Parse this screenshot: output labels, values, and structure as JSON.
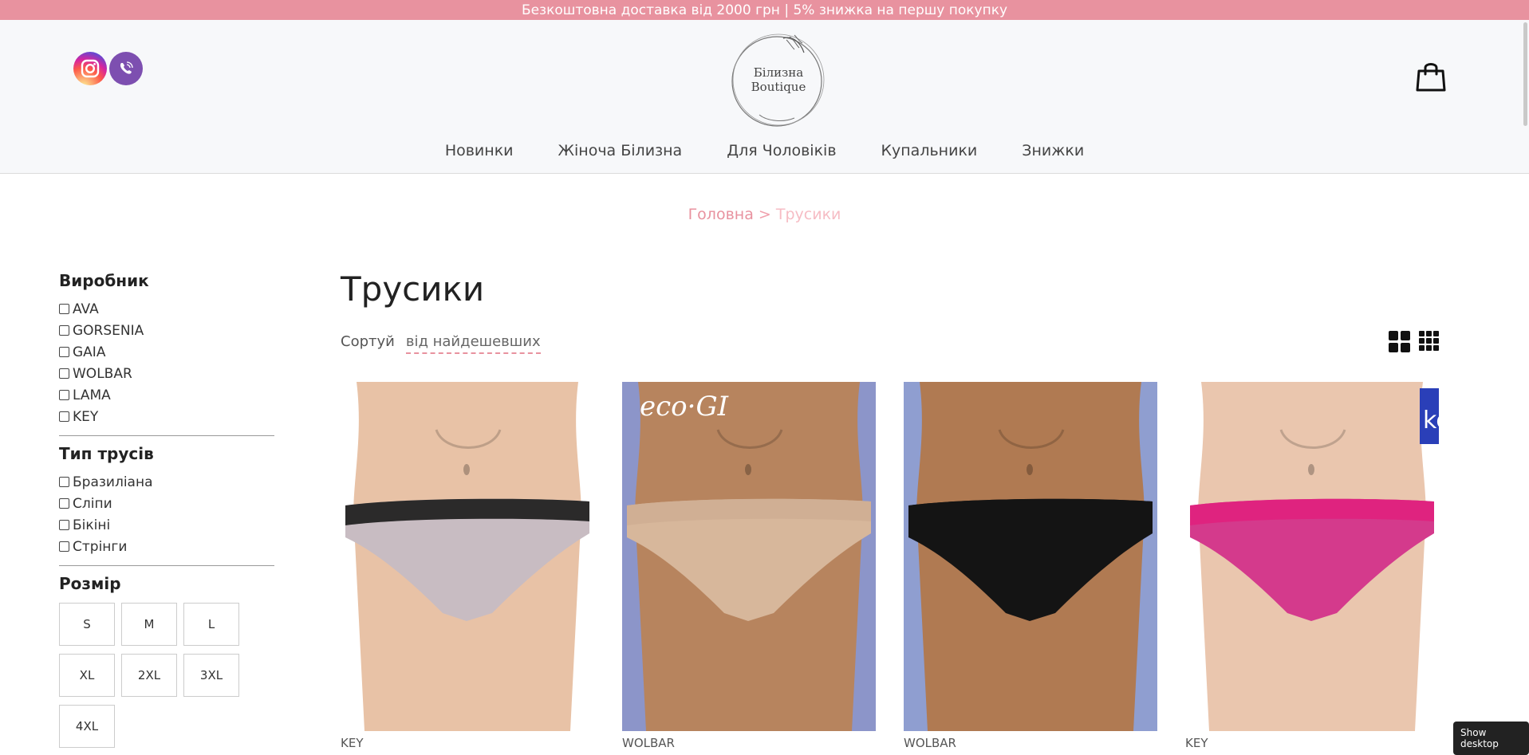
{
  "topbar": {
    "text": "Безкоштовна доставка від 2000 грн | 5% знижка на першу покупку"
  },
  "header": {
    "logo_line1": "Білизна",
    "logo_line2": "Boutique",
    "social": [
      "instagram-icon",
      "viber-icon"
    ],
    "cart_icon": "shopping-bag-icon"
  },
  "nav": {
    "items": [
      {
        "label": "Новинки"
      },
      {
        "label": "Жіноча Білизна"
      },
      {
        "label": "Для Чоловіків"
      },
      {
        "label": "Купальники"
      },
      {
        "label": "Знижки"
      }
    ]
  },
  "breadcrumb": {
    "home": "Головна",
    "sep": ">",
    "current": "Трусики"
  },
  "filters": {
    "maker": {
      "title": "Виробник",
      "options": [
        {
          "label": "AVA"
        },
        {
          "label": "GORSENIA"
        },
        {
          "label": "GAIA"
        },
        {
          "label": "WOLBAR"
        },
        {
          "label": "LAMA"
        },
        {
          "label": "KEY"
        }
      ]
    },
    "type": {
      "title": "Тип трусів",
      "options": [
        {
          "label": "Бразиліана"
        },
        {
          "label": "Сліпи"
        },
        {
          "label": "Бікіні"
        },
        {
          "label": "Стрінги"
        }
      ]
    },
    "size": {
      "title": "Розмір",
      "options": [
        "S",
        "M",
        "L",
        "XL",
        "2XL",
        "3XL",
        "4XL"
      ]
    }
  },
  "main": {
    "title": "Трусики",
    "sort_label": "Сортуй",
    "sort_value": "від найдешевших",
    "view_icons": [
      "grid-2-icon",
      "grid-3-icon"
    ]
  },
  "products": [
    {
      "brand": "KEY",
      "skin": "#e8c2a6",
      "bg": "#ffffff",
      "color": "#c8bcc2",
      "band": "#1a1a1a"
    },
    {
      "brand": "WOLBAR",
      "skin": "#b7845e",
      "bg": "#8c95c9",
      "color": "#d7b79b",
      "band": "#cfae93",
      "overlay": "eco·GI"
    },
    {
      "brand": "WOLBAR",
      "skin": "#b07a52",
      "bg": "#8f9ed0",
      "color": "#141414",
      "band": "#141414"
    },
    {
      "brand": "KEY",
      "skin": "#eac6ae",
      "bg": "#ffffff",
      "color": "#d43a8c",
      "band": "#e0217d",
      "overlay": "ke"
    }
  ],
  "misc": {
    "show_desktop": "Show desktop"
  },
  "colors": {
    "accent": "#e8929f",
    "topbar": "#e8929f"
  }
}
